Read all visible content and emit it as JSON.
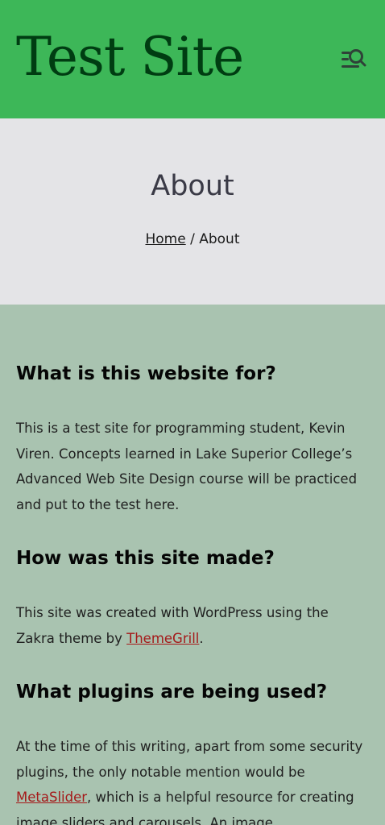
{
  "header": {
    "site_title": "Test Site",
    "menu_icon": "menu-search-icon",
    "background_color": "#3db758",
    "title_color": "#003d12"
  },
  "hero": {
    "page_title": "About",
    "breadcrumb_home": "Home",
    "breadcrumb_separator": "/",
    "breadcrumb_current": "About"
  },
  "content": {
    "sections": [
      {
        "heading": "What is this website for?",
        "paragraph": "This is a test site for programming student, Kevin Viren. Concepts learned in Lake Superior College’s Advanced Web Site Design course will be practiced and put to the test here."
      },
      {
        "heading": "How was this site made?",
        "paragraph_before_link": "This site was created with WordPress using the Zakra theme by ",
        "link": "ThemeGrill",
        "paragraph_after_link": "."
      },
      {
        "heading": "What plugins are being used?",
        "paragraph_before_link": "At the time of this writing, apart from some security plugins, the only notable mention would be ",
        "link": "MetaSlider",
        "paragraph_after_link": ", which is a helpful resource for creating image sliders and carousels. An image"
      }
    ],
    "link_color": "#a51a1a",
    "background_color": "#a9c3b0"
  }
}
